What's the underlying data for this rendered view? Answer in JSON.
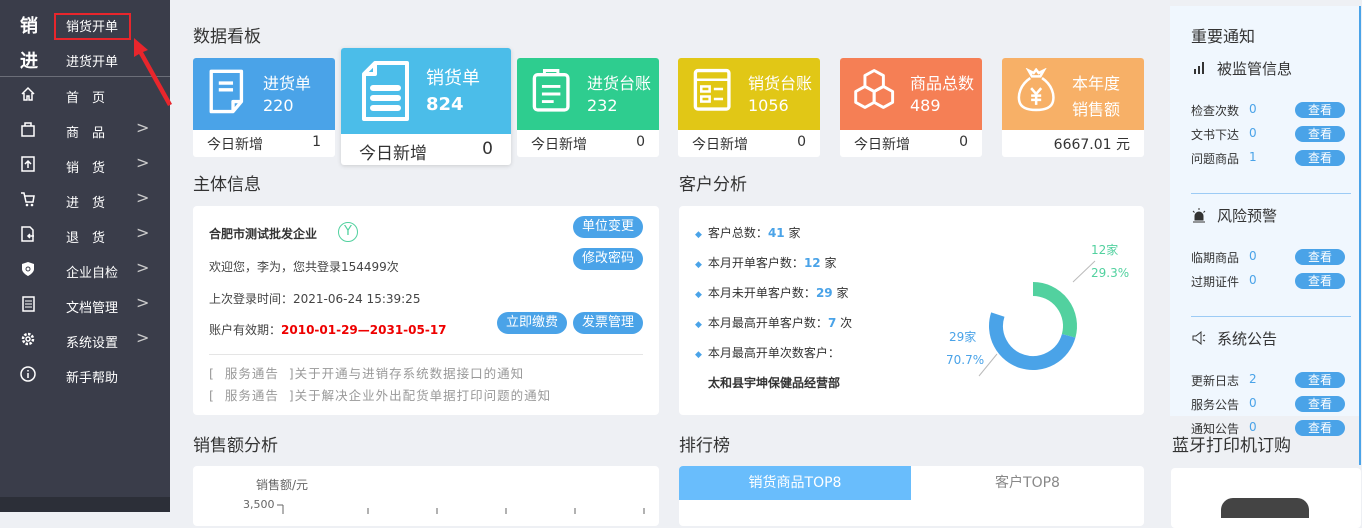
{
  "sidebar": {
    "quick": [
      {
        "char": "销",
        "label": "销货开单"
      },
      {
        "char": "进",
        "label": "进货开单"
      }
    ],
    "items": [
      {
        "label": "首　页",
        "icon": "home-icon"
      },
      {
        "label": "商　品",
        "icon": "bag-icon"
      },
      {
        "label": "销　货",
        "icon": "upload-icon"
      },
      {
        "label": "进　货",
        "icon": "cart-icon"
      },
      {
        "label": "退　货",
        "icon": "return-doc-icon"
      },
      {
        "label": "企业自检",
        "icon": "shield-icon"
      },
      {
        "label": "文档管理",
        "icon": "document-icon"
      },
      {
        "label": "系统设置",
        "icon": "gear-icon"
      },
      {
        "label": "新手帮助",
        "icon": "info-icon"
      }
    ]
  },
  "dashboard": {
    "title": "数据看板",
    "cards": [
      {
        "title": "进货单",
        "value": "220",
        "foot_label": "今日新增",
        "foot_value": "1",
        "color": "#4aa3e8"
      },
      {
        "title": "销货单",
        "value": "824",
        "foot_label": "今日新增",
        "foot_value": "0",
        "color": "#4bbde9"
      },
      {
        "title": "进货台账",
        "value": "232",
        "foot_label": "今日新增",
        "foot_value": "0",
        "color": "#2ecd8f"
      },
      {
        "title": "销货台账",
        "value": "1056",
        "foot_label": "今日新增",
        "foot_value": "0",
        "color": "#e1c716"
      },
      {
        "title": "商品总数",
        "value": "489",
        "foot_label": "今日新增",
        "foot_value": "0",
        "color": "#f57f55"
      },
      {
        "title": "本年度",
        "title2": "销售额",
        "foot_value": "6667.01 元",
        "color": "#f7b067"
      }
    ]
  },
  "entity": {
    "title": "主体信息",
    "company": "合肥市测试批发企业",
    "badge": "Y",
    "welcome": "欢迎您，李为，您共登录154499次",
    "last_login": "上次登录时间：2021-06-24 15:39:25",
    "validity_label": "账户有效期：",
    "validity": "2010-01-29—2031-05-17",
    "buttons": {
      "change": "单位变更",
      "password": "修改密码",
      "pay": "立即缴费",
      "invoice": "发票管理"
    },
    "notices": [
      "[  服务通告  ]关于开通与进销存系统数据接口的通知",
      "[  服务通告  ]关于解决企业外出配货单据打印问题的通知"
    ]
  },
  "customers": {
    "title": "客户分析",
    "lines": [
      {
        "pre": "客户总数：",
        "num": "41",
        "post": " 家"
      },
      {
        "pre": "本月开单客户数：",
        "num": "12",
        "post": " 家"
      },
      {
        "pre": "本月未开单客户数：",
        "num": "29",
        "post": " 家"
      },
      {
        "pre": "本月最高开单客户数：",
        "num": "7",
        "post": " 次"
      },
      {
        "pre": "本月最高开单次数客户：",
        "num": "",
        "post": ""
      }
    ],
    "top_customer": "太和县宇坤保健品经营部",
    "chart_data": {
      "type": "pie",
      "series": [
        {
          "name": "开单",
          "value": 12,
          "label": "12家",
          "percent": "29.3%",
          "color": "#52d19f"
        },
        {
          "name": "未开单",
          "value": 29,
          "label": "29家",
          "percent": "70.7%",
          "color": "#4aa3e8"
        }
      ]
    }
  },
  "notify": {
    "title": "重要通知",
    "sections": [
      {
        "title": "被监管信息",
        "icon": "bar-chart-icon",
        "rows": [
          {
            "label": "检查次数",
            "value": "0"
          },
          {
            "label": "文书下达",
            "value": "0"
          },
          {
            "label": "问题商品",
            "value": "1"
          }
        ]
      },
      {
        "title": "风险预警",
        "icon": "alarm-icon",
        "rows": [
          {
            "label": "临期商品",
            "value": "0"
          },
          {
            "label": "过期证件",
            "value": "0"
          }
        ]
      },
      {
        "title": "系统公告",
        "icon": "speaker-icon",
        "rows": [
          {
            "label": "更新日志",
            "value": "2"
          },
          {
            "label": "服务公告",
            "value": "0"
          },
          {
            "label": "通知公告",
            "value": "0"
          }
        ]
      }
    ],
    "view": "查看"
  },
  "sales": {
    "title": "销售额分析",
    "ylabel": "销售额/元",
    "ytick": "3,500"
  },
  "ranking": {
    "title": "排行榜",
    "tabs": [
      "销货商品TOP8",
      "客户TOP8"
    ]
  },
  "printer": {
    "title": "蓝牙打印机订购"
  }
}
